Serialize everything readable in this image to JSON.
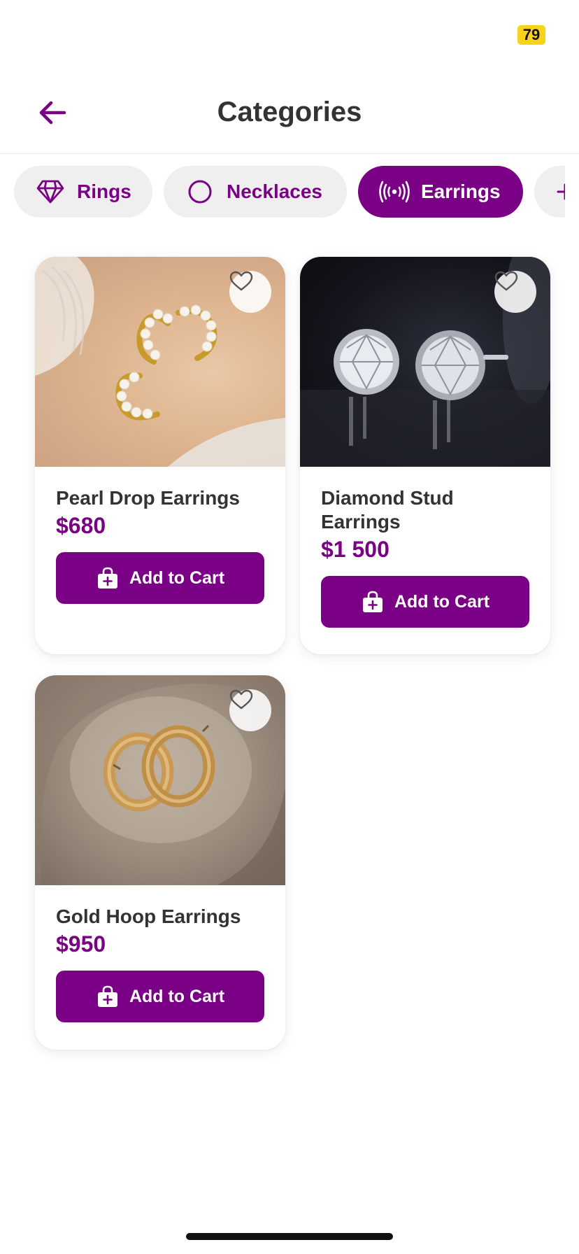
{
  "status_bar": {
    "battery": "79"
  },
  "header": {
    "title": "Categories",
    "back_icon": "arrow-left-icon"
  },
  "categories": [
    {
      "label": "Rings",
      "icon": "diamond-icon",
      "active": false
    },
    {
      "label": "Necklaces",
      "icon": "circle-icon",
      "active": false
    },
    {
      "label": "Earrings",
      "icon": "broadcast-icon",
      "active": true
    },
    {
      "label": "",
      "icon": "more-icon",
      "active": false
    }
  ],
  "products": [
    {
      "name": "Pearl Drop Earrings",
      "price": "$680",
      "button": "Add to Cart",
      "image": "pearl-earrings-photo"
    },
    {
      "name": "Diamond Stud Earrings",
      "price": "$1 500",
      "button": "Add to Cart",
      "image": "diamond-studs-photo"
    },
    {
      "name": "Gold Hoop Earrings",
      "price": "$950",
      "button": "Add to Cart",
      "image": "gold-hoops-photo"
    }
  ],
  "colors": {
    "brand": "#7a0085",
    "chip_bg": "#efefef",
    "battery_badge": "#f8d31c",
    "text": "#333336"
  }
}
